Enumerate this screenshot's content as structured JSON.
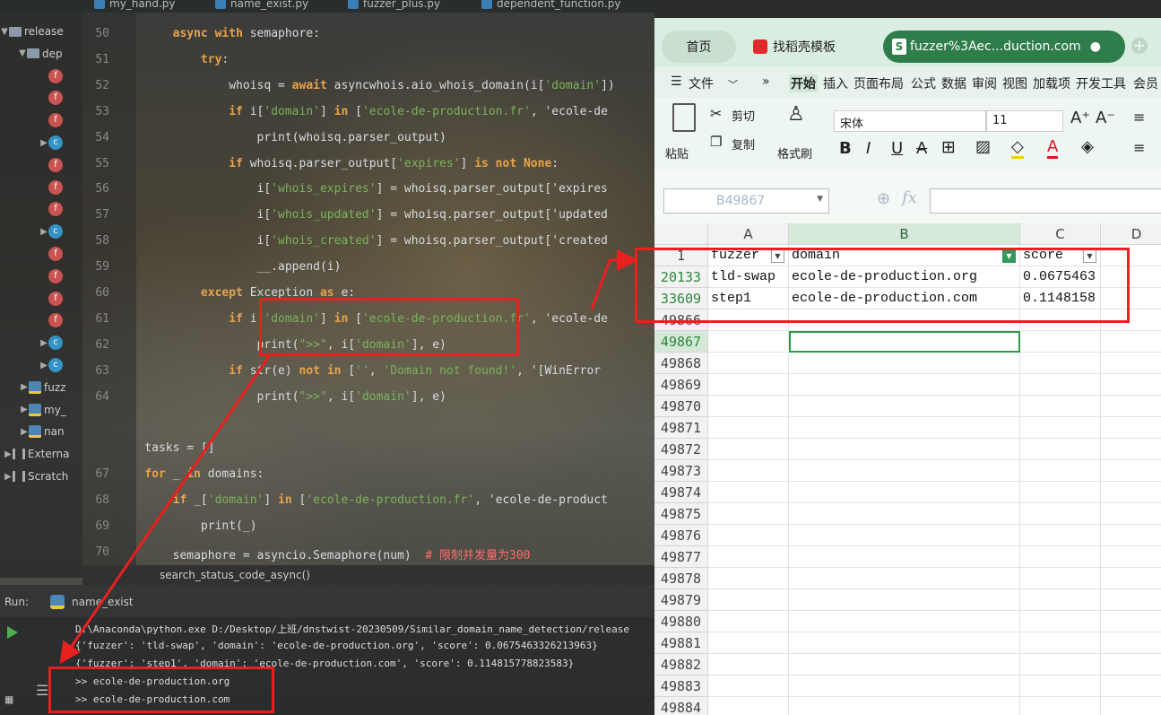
{
  "ide": {
    "tabs": [
      "my_hand.py",
      "name_exist.py",
      "fuzzer_plus.py",
      "dependent_function.py"
    ],
    "project": [
      {
        "label": "release",
        "type": "folder",
        "arrow": "▼"
      },
      {
        "label": "dep",
        "type": "folder",
        "arrow": "▼"
      },
      {
        "label": "f",
        "type": "f"
      },
      {
        "label": "f",
        "type": "f"
      },
      {
        "label": "f",
        "type": "f"
      },
      {
        "label": "C",
        "type": "c",
        "arrow": "▶"
      },
      {
        "label": "f",
        "type": "f"
      },
      {
        "label": "f",
        "type": "f"
      },
      {
        "label": "f",
        "type": "f"
      },
      {
        "label": "C",
        "type": "c",
        "arrow": "▶"
      },
      {
        "label": "f",
        "type": "f"
      },
      {
        "label": "f",
        "type": "f"
      },
      {
        "label": "f",
        "type": "f"
      },
      {
        "label": "f",
        "type": "f"
      },
      {
        "label": "C",
        "type": "c",
        "arrow": "▶"
      },
      {
        "label": "C",
        "type": "c",
        "arrow": "▶"
      },
      {
        "label": "fuzz",
        "type": "py",
        "arrow": "▶"
      },
      {
        "label": "my_",
        "type": "py",
        "arrow": "▶"
      },
      {
        "label": "nan",
        "type": "py",
        "arrow": "▶"
      },
      {
        "label": "Externa",
        "type": "lib",
        "arrow": "▶"
      },
      {
        "label": "Scratch",
        "type": "scratch",
        "arrow": "▶"
      }
    ],
    "lines": [
      {
        "n": "50",
        "t": "        async with semaphore:"
      },
      {
        "n": "51",
        "t": "            try:"
      },
      {
        "n": "52",
        "t": "                whoisq = await asyncwhois.aio_whois_domain(i['domain'])"
      },
      {
        "n": "53",
        "t": "                if i['domain'] in ['ecole-de-production.fr', 'ecole-de"
      },
      {
        "n": "54",
        "t": "                    print(whoisq.parser_output)"
      },
      {
        "n": "55",
        "t": "                if whoisq.parser_output['expires'] is not None:"
      },
      {
        "n": "56",
        "t": "                    i['whois_expires'] = whoisq.parser_output['expires"
      },
      {
        "n": "57",
        "t": "                    i['whois_updated'] = whoisq.parser_output['updated"
      },
      {
        "n": "58",
        "t": "                    i['whois_created'] = whoisq.parser_output['created"
      },
      {
        "n": "59",
        "t": "                    __.append(i)"
      },
      {
        "n": "60",
        "t": "            except Exception as e:"
      },
      {
        "n": "61",
        "t": "                if i['domain'] in ['ecole-de-production.fr', 'ecole-de"
      },
      {
        "n": "62",
        "t": "                    print(\">>\", i['domain'], e)"
      },
      {
        "n": "63",
        "t": "                if str(e) not in ['', 'Domain not found!', '[WinError"
      },
      {
        "n": "64",
        "t": "                    print(\">>\", i['domain'], e)"
      },
      {
        "n": "",
        "t": ""
      },
      {
        "n": "",
        "t": "    tasks = []"
      },
      {
        "n": "67",
        "t": "    for _ in domains:"
      },
      {
        "n": "68",
        "t": "        if _['domain'] in ['ecole-de-production.fr', 'ecole-de-product"
      },
      {
        "n": "69",
        "t": "            print(_)"
      },
      {
        "n": "70",
        "t": "        semaphore = asyncio.Semaphore(num)  # 限制并发量为300"
      }
    ],
    "breadcrumb": "search_status_code_async()",
    "run_label": "Run:",
    "run_config": "name_exist",
    "console": [
      "D:\\Anaconda\\python.exe D:/Desktop/上班/dnstwist-20230509/Similar_domain_name_detection/release",
      "{'fuzzer': 'tld-swap', 'domain': 'ecole-de-production.org', 'score': 0.0675463326213963}",
      "{'fuzzer': 'step1', 'domain': 'ecole-de-production.com', 'score': 0.114815778823583}",
      ">> ecole-de-production.org",
      ">> ecole-de-production.com"
    ]
  },
  "excel": {
    "tabs": {
      "home": "首页",
      "template": "找稻壳模板",
      "doc": "fuzzer%3Aec...duction.com"
    },
    "menu": [
      "文件",
      "开始",
      "插入",
      "页面布局",
      "公式",
      "数据",
      "审阅",
      "视图",
      "加载项",
      "开发工具",
      "会员"
    ],
    "ribbon": {
      "paste": "粘贴",
      "cut": "剪切",
      "copy": "复制",
      "format_painter": "格式刷",
      "font": "宋体",
      "size": "11",
      "bold": "B",
      "italic": "I",
      "underline": "U"
    },
    "namebox": "B49867",
    "fx": "fx",
    "columns": [
      "A",
      "B",
      "C",
      "D"
    ],
    "header_row": {
      "num": "1",
      "a": "fuzzer",
      "b": "domain",
      "c": "score"
    },
    "rows": [
      {
        "num": "20133",
        "a": "tld-swap",
        "b": "ecole-de-production.org",
        "c": "0.0675463"
      },
      {
        "num": "33609",
        "a": "step1",
        "b": "ecole-de-production.com",
        "c": "0.1148158"
      }
    ],
    "empty_rows": [
      "49866",
      "49867",
      "49868",
      "49869",
      "49870",
      "49871",
      "49872",
      "49873",
      "49874",
      "49875",
      "49876",
      "49877",
      "49878",
      "49879",
      "49880",
      "49881",
      "49882",
      "49883",
      "49884"
    ]
  }
}
